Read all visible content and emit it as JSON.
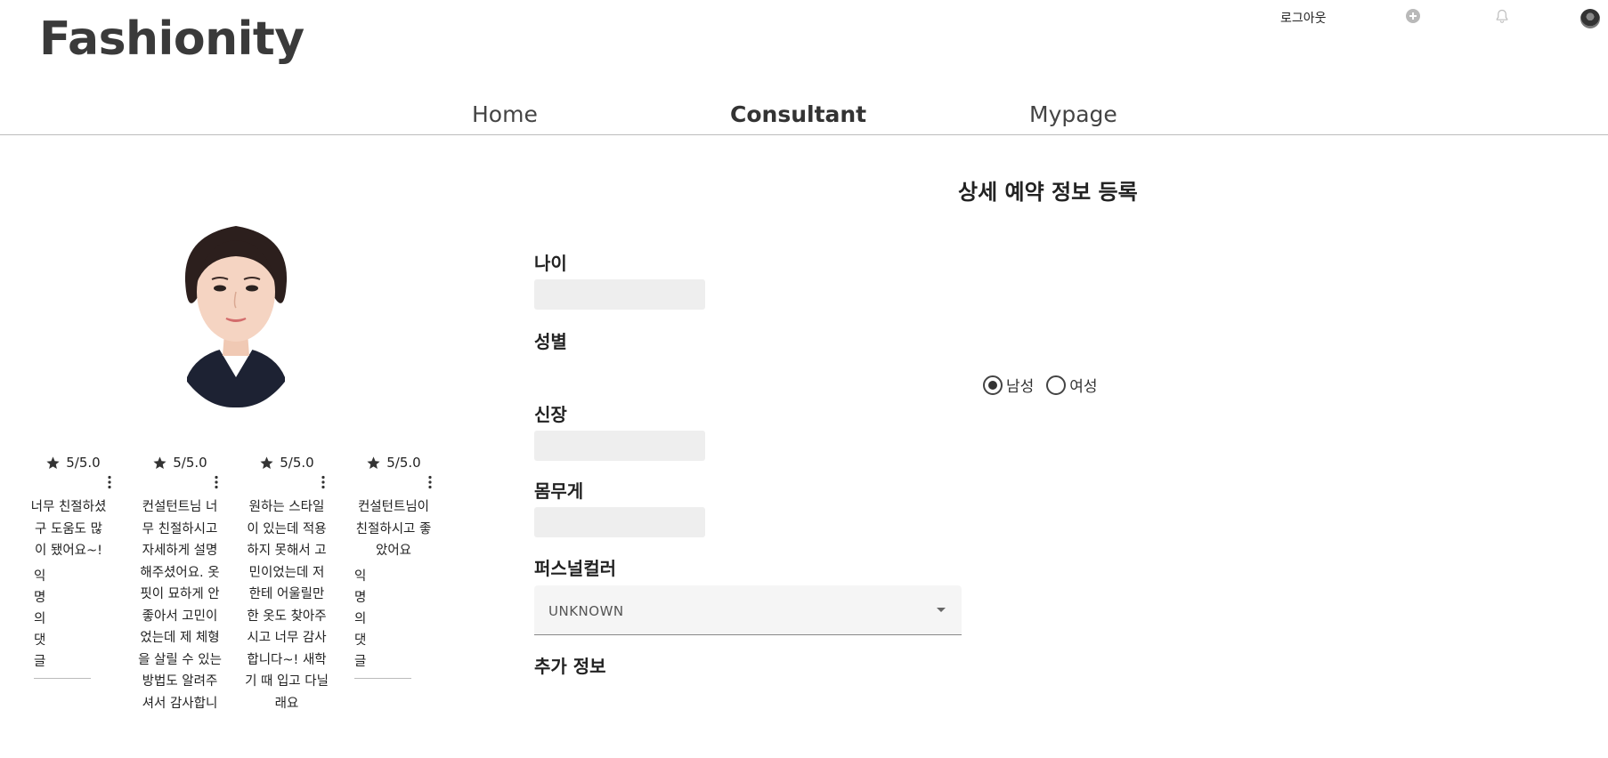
{
  "header": {
    "logo": "Fashionity",
    "logout_label": "로그아웃",
    "icons": [
      "plus-circle-icon",
      "bell-icon",
      "avatar"
    ]
  },
  "nav": {
    "items": [
      {
        "label": "Home"
      },
      {
        "label": "Consultant",
        "active": true
      },
      {
        "label": "Mypage"
      }
    ]
  },
  "consultant": {
    "photo": "profile-photo",
    "reviews": [
      {
        "rating": "5/5.0",
        "text": "너무 친절하셨구 도움도 많이 됐어요~!",
        "comments": "익명의댓글"
      },
      {
        "rating": "5/5.0",
        "text": "컨설턴트님 너무 친절하시고 자세하게 설명해주셨어요. 옷 핏이 묘하게 안 좋아서 고민이었는데 제 체형을 살릴 수 있는 방법도 알려주셔서 감사합니",
        "comments": ""
      },
      {
        "rating": "5/5.0",
        "text": "원하는 스타일이 있는데 적용하지 못해서 고민이었는데 저한테 어울릴만한 옷도 찾아주시고 너무 감사합니다~! 새학기 때 입고 다닐래요",
        "comments": ""
      },
      {
        "rating": "5/5.0",
        "text": "컨설턴트님이 친절하시고 좋았어요",
        "comments": "익명의댓글"
      }
    ]
  },
  "form": {
    "title": "상세 예약 정보 등록",
    "age_label": "나이",
    "age_value": "",
    "gender_label": "성별",
    "gender_options": [
      {
        "label": "남성",
        "checked": true
      },
      {
        "label": "여성",
        "checked": false
      }
    ],
    "height_label": "신장",
    "height_value": "",
    "weight_label": "몸무게",
    "weight_value": "",
    "personal_color_label": "퍼스널컬러",
    "personal_color_value": "UNKNOWN",
    "extra_label": "추가 정보"
  },
  "colors": {
    "text": "#333333",
    "input_bg": "#eeeeee",
    "nav_border": "#bdbdbd"
  }
}
